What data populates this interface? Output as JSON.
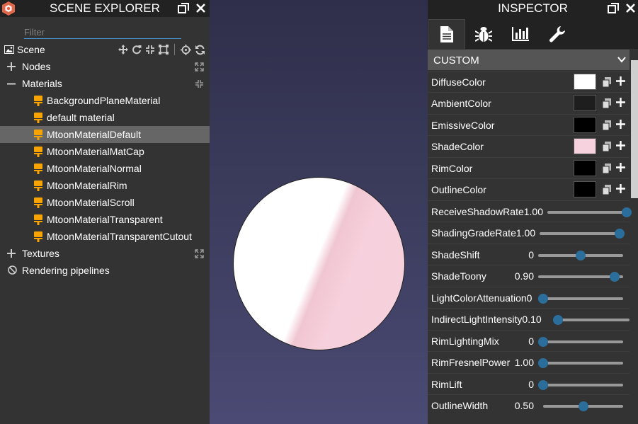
{
  "scene_explorer": {
    "title": "SCENE EXPLORER",
    "filter_placeholder": "Filter",
    "scene_label": "Scene",
    "nodes_label": "Nodes",
    "materials_label": "Materials",
    "materials": [
      "BackgroundPlaneMaterial",
      "default material",
      "MtoonMaterialDefault",
      "MtoonMaterialMatCap",
      "MtoonMaterialNormal",
      "MtoonMaterialRim",
      "MtoonMaterialScroll",
      "MtoonMaterialTransparent",
      "MtoonMaterialTransparentCutout"
    ],
    "selected_material": "MtoonMaterialDefault",
    "textures_label": "Textures",
    "rendering_label": "Rendering pipelines"
  },
  "inspector": {
    "title": "INSPECTOR",
    "section_label": "CUSTOM",
    "colors": [
      {
        "label": "DiffuseColor",
        "color": "#ffffff"
      },
      {
        "label": "AmbientColor",
        "color": "#1e1e1e"
      },
      {
        "label": "EmissiveColor",
        "color": "#000000"
      },
      {
        "label": "ShadeColor",
        "color": "#f6d2de"
      },
      {
        "label": "RimColor",
        "color": "#000000"
      },
      {
        "label": "OutlineColor",
        "color": "#000000"
      }
    ],
    "sliders": [
      {
        "label": "ReceiveShadowRate",
        "value": "1.00",
        "fraction": 1.0
      },
      {
        "label": "ShadingGradeRate",
        "value": "1.00",
        "fraction": 1.0
      },
      {
        "label": "ShadeShift",
        "value": "0",
        "fraction": 0.5
      },
      {
        "label": "ShadeToony",
        "value": "0.90",
        "fraction": 0.9
      },
      {
        "label": "LightColorAttenuation",
        "value": "0",
        "fraction": 0.0
      },
      {
        "label": "IndirectLightIntensity",
        "value": "0.10",
        "fraction": 0.0
      },
      {
        "label": "RimLightingMix",
        "value": "0",
        "fraction": 0.0
      },
      {
        "label": "RimFresnelPower",
        "value": "1.00",
        "fraction": 0.0
      },
      {
        "label": "RimLift",
        "value": "0",
        "fraction": 0.0
      },
      {
        "label": "OutlineWidth",
        "value": "0.50",
        "fraction": 0.5
      }
    ]
  },
  "colors": {
    "panel_bg": "#333333",
    "header_bg": "#222222",
    "selected_row": "#666666",
    "accent_blue": "#2c6e9b",
    "material_icon": "#f7a300"
  }
}
